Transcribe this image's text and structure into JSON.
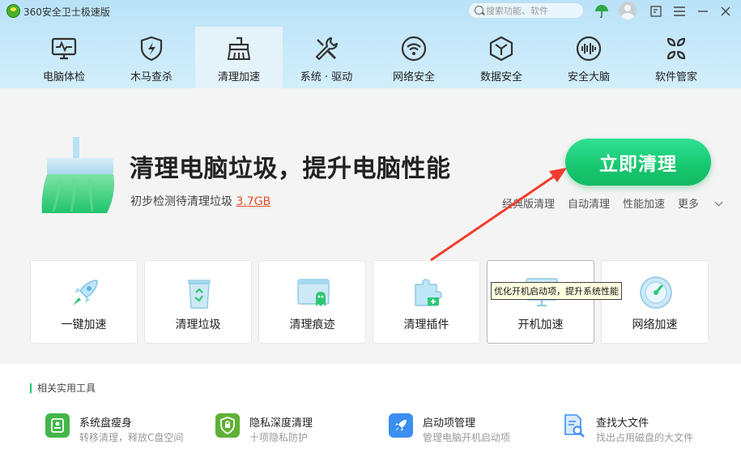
{
  "app": {
    "title": "360安全卫士极速版"
  },
  "titlebar": {
    "search_placeholder": "搜索功能、软件"
  },
  "nav": {
    "items": [
      {
        "label": "电脑体检",
        "icon": "monitor-pulse-icon"
      },
      {
        "label": "木马查杀",
        "icon": "shield-bolt-icon"
      },
      {
        "label": "清理加速",
        "icon": "broom-icon",
        "active": true
      },
      {
        "label": "系统 · 驱动",
        "icon": "wrench-screwdriver-icon"
      },
      {
        "label": "网络安全",
        "icon": "wifi-icon"
      },
      {
        "label": "数据安全",
        "icon": "cube-icon"
      },
      {
        "label": "安全大脑",
        "icon": "brain-icon"
      },
      {
        "label": "软件管家",
        "icon": "apps-icon"
      }
    ]
  },
  "main": {
    "headline": "清理电脑垃圾，提升电脑性能",
    "sub_prefix": "初步检测待清理垃圾",
    "junk_size": "3.7GB",
    "clean_button": "立即清理",
    "links": [
      "经典版清理",
      "自动清理",
      "性能加速"
    ],
    "more_label": "更多"
  },
  "tools": [
    {
      "label": "一键加速",
      "icon": "rocket-icon"
    },
    {
      "label": "清理垃圾",
      "icon": "recycle-bin-icon"
    },
    {
      "label": "清理痕迹",
      "icon": "trace-window-icon"
    },
    {
      "label": "清理插件",
      "icon": "puzzle-icon"
    },
    {
      "label": "开机加速",
      "icon": "startup-monitor-icon"
    },
    {
      "label": "网络加速",
      "icon": "speedometer-icon"
    }
  ],
  "tooltip": "优化开机启动项，提升系统性能",
  "utilities": {
    "section_title": "相关实用工具",
    "items": [
      {
        "title": "系统盘瘦身",
        "desc": "转移清理，释放C盘空间",
        "icon": "disk-icon",
        "color": "#43b649"
      },
      {
        "title": "隐私深度清理",
        "desc": "十项隐私防护",
        "icon": "privacy-shield-icon",
        "color": "#5fb135"
      },
      {
        "title": "启动项管理",
        "desc": "管理电脑开机启动项",
        "icon": "rocket-icon",
        "color": "#3b8ff0"
      },
      {
        "title": "查找大文件",
        "desc": "找出占用磁盘的大文件",
        "icon": "file-search-icon",
        "color": "#3b8ff0"
      }
    ]
  },
  "colors": {
    "accent": "#17c76f",
    "link": "#e0502a",
    "header_bg": "#c3e6f9"
  }
}
